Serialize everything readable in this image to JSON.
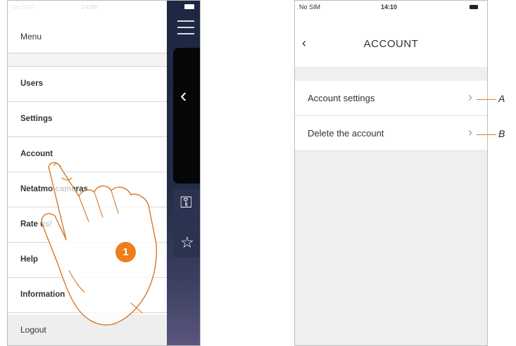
{
  "left_screen": {
    "status": {
      "carrier": "No SIM",
      "time": "14:09"
    },
    "menu": {
      "header": "Menu",
      "items": [
        {
          "label": "Users"
        },
        {
          "label": "Settings"
        },
        {
          "label": "Account"
        },
        {
          "label": "Netatmo cameras"
        },
        {
          "label": "Rate us!"
        },
        {
          "label": "Help"
        },
        {
          "label": "Information"
        }
      ],
      "logout": "Logout"
    },
    "step_badge": "1",
    "icons": [
      "hamburger-icon",
      "chevron-left-icon",
      "key-icon",
      "star-icon"
    ]
  },
  "right_screen": {
    "status": {
      "carrier": "No SIM",
      "time": "14:10"
    },
    "nav": {
      "back": "‹",
      "title": "ACCOUNT"
    },
    "items": [
      {
        "label": "Account settings",
        "callout": "A"
      },
      {
        "label": "Delete the account",
        "callout": "B"
      }
    ]
  },
  "colors": {
    "accent": "#ef7d1a",
    "dark_panel": "#1d2742"
  }
}
